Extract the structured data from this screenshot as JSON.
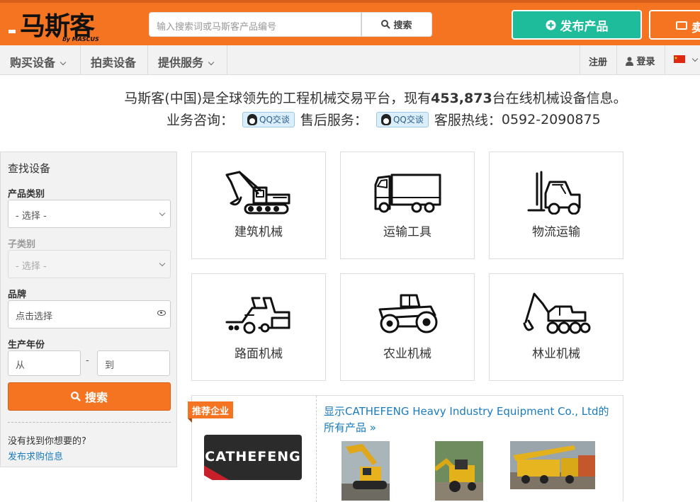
{
  "header": {
    "logo_text": "马斯客",
    "logo_by": "by MASCUS",
    "search_placeholder": "输入搜索词或马斯客产品编号",
    "search_button": "搜索",
    "publish_button": "发布产品",
    "sell_button": "卖"
  },
  "nav": {
    "items": [
      "购买设备",
      "拍卖设备",
      "提供服务"
    ],
    "register": "注册",
    "login": "登录"
  },
  "intro": {
    "line1_prefix": "马斯客(中国)是全球领先的工程机械交易平台，现有",
    "count": "453,873",
    "line1_suffix": "台在线机械设备信息。",
    "biz_label": "业务咨询：",
    "qq_label": "QQ交谈",
    "after_label": "售后服务：",
    "hotline_label": "客服热线：",
    "hotline": "0592-2090875"
  },
  "sidebar": {
    "heading": "查找设备",
    "category_label": "产品类别",
    "category_value": "- 选择 -",
    "subcategory_label": "子类别",
    "subcategory_value": "- 选择 -",
    "brand_label": "品牌",
    "brand_value": "点击选择",
    "year_label": "生产年份",
    "year_from": "从",
    "year_sep": "-",
    "year_to": "到",
    "search_button": "搜索",
    "not_found": "没有找到你想要的?",
    "post_request": "发布求购信息"
  },
  "categories": [
    {
      "name": "建筑机械",
      "icon": "excavator-icon"
    },
    {
      "name": "运输工具",
      "icon": "truck-icon"
    },
    {
      "name": "物流运输",
      "icon": "forklift-icon"
    },
    {
      "name": "路面机械",
      "icon": "road-roller-icon"
    },
    {
      "name": "农业机械",
      "icon": "tractor-icon"
    },
    {
      "name": "林业机械",
      "icon": "forestry-machine-icon"
    }
  ],
  "featured": {
    "tag": "推荐企业",
    "brand_logo_text": "CATHEFENG",
    "show_all_link": "显示CATHEFENG Heavy Industry Equipment Co., Ltd的所有产品 »"
  },
  "colors": {
    "brand_orange": "#f47421",
    "publish_green": "#1ebc9a",
    "link_blue": "#1a7bbf"
  }
}
